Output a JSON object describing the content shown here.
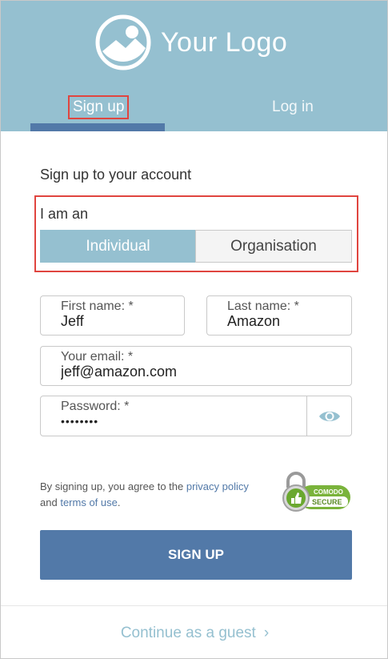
{
  "header": {
    "logo_text": "Your Logo",
    "tabs": [
      {
        "label": "Sign up",
        "active": true
      },
      {
        "label": "Log in",
        "active": false
      }
    ]
  },
  "form": {
    "subtitle": "Sign up to your account",
    "account_type": {
      "label": "I am an",
      "options": [
        {
          "label": "Individual",
          "selected": true
        },
        {
          "label": "Organisation",
          "selected": false
        }
      ]
    },
    "fields": {
      "first_name": {
        "label": "First name: *",
        "value": "Jeff"
      },
      "last_name": {
        "label": "Last name: *",
        "value": "Amazon"
      },
      "email": {
        "label": "Your email: *",
        "value": "jeff@amazon.com"
      },
      "password": {
        "label": "Password: *",
        "value": "••••••••"
      }
    },
    "terms": {
      "prefix": "By signing up, you agree to the",
      "privacy_link": "privacy policy",
      "and": "and",
      "terms_link": "terms of use",
      "suffix": "."
    },
    "seal": {
      "line1": "COMODO",
      "line2": "SECURE"
    },
    "submit_label": "SIGN UP"
  },
  "footer": {
    "guest_label": "Continue as a guest",
    "guest_chevron": "›"
  },
  "colors": {
    "header_bg": "#95c0d0",
    "accent_blue": "#5279a8",
    "highlight_red": "#e0453f"
  },
  "icons": {
    "logo": "logo-mark-icon",
    "password_toggle": "eye-icon",
    "seal": "comodo-secure-seal"
  }
}
